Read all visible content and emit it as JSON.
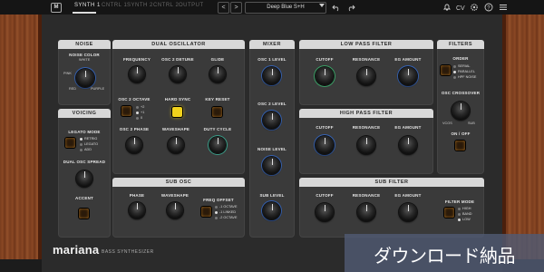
{
  "topbar": {
    "logo": "M",
    "tabs": [
      "SYNTH 1",
      "CNTRL 1",
      "SYNTH 2",
      "CNTRL 2",
      "OUTPUT"
    ],
    "prev": "<",
    "next": ">",
    "preset": "Deep Blue S+H",
    "icons": [
      "undo-icon",
      "redo-icon",
      "bell-icon",
      "cpu-icon",
      "settings-icon",
      "help-icon",
      "menu-icon"
    ]
  },
  "sections": {
    "noise": {
      "title": "NOISE",
      "color_label": "NOISE COLOR",
      "options": [
        "WHITE",
        "PINK",
        "RED",
        "PURPLE"
      ]
    },
    "voicing": {
      "title": "VOICING",
      "legato_label": "LEGATO MODE",
      "legato_options": [
        "RETRIG",
        "LEGATO",
        "ADD"
      ],
      "spread_label": "DUAL OSC SPREAD",
      "accent_label": "ACCENT"
    },
    "dual_osc": {
      "title": "DUAL OSCILLATOR",
      "freq": "FREQUENCY",
      "detune": "OSC 2 DETUNE",
      "glide": "GLIDE",
      "octave": "OSC 2 OCTAVE",
      "octave_options": [
        "+2",
        "+1",
        "0"
      ],
      "hard_sync": "HARD SYNC",
      "key_reset": "KEY RESET",
      "phase": "OSC 2 PHASE",
      "waveshape": "WAVESHAPE",
      "duty": "DUTY CYCLE"
    },
    "sub_osc": {
      "title": "SUB OSC",
      "phase": "PHASE",
      "waveshape": "WAVESHAPE",
      "freq_offset": "FREQ OFFSET",
      "offset_options": [
        "-1 OCTAVE",
        "-1 LINKED",
        "-2 OCTAVE"
      ]
    },
    "mixer": {
      "title": "MIXER",
      "osc1": "OSC 1 LEVEL",
      "osc2": "OSC 2 LEVEL",
      "noise": "NOISE LEVEL",
      "sub": "SUB LEVEL"
    },
    "lpf": {
      "title": "LOW PASS FILTER",
      "cutoff": "CUTOFF",
      "resonance": "RESONANCE",
      "eg": "EG AMOUNT"
    },
    "hpf": {
      "title": "HIGH PASS FILTER",
      "cutoff": "CUTOFF",
      "resonance": "RESONANCE",
      "eg": "EG AMOUNT"
    },
    "sub_filter": {
      "title": "SUB FILTER",
      "cutoff": "CUTOFF",
      "resonance": "RESONANCE",
      "eg": "EG AMOUNT",
      "mode": "FILTER MODE",
      "mode_options": [
        "HIGH",
        "BAND",
        "LOW"
      ]
    },
    "filters": {
      "title": "FILTERS",
      "order": "ORDER",
      "order_options": [
        "SERIAL",
        "PARALLEL",
        "HPF NOISE"
      ],
      "crossover": "OSC CROSSOVER",
      "cross_left": "VCOS",
      "cross_right": "SUB",
      "onoff": "ON / OFF"
    }
  },
  "brand": {
    "name": "mariana",
    "sub": "BASS SYNTHESIZER"
  },
  "overlay": "ダウンロード納品"
}
